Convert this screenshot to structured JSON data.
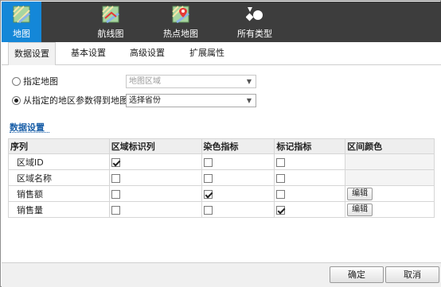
{
  "ribbon": {
    "chart_types": [
      {
        "label": "地图",
        "icon": "map-icon",
        "active": true
      },
      {
        "label": "航线图",
        "icon": "route-map-icon",
        "active": false
      },
      {
        "label": "热点地图",
        "icon": "hotspot-map-icon",
        "active": false
      },
      {
        "label": "所有类型",
        "icon": "all-types-icon",
        "active": false
      }
    ]
  },
  "tabs": [
    {
      "label": "数据设置",
      "active": true
    },
    {
      "label": "基本设置",
      "active": false
    },
    {
      "label": "高级设置",
      "active": false
    },
    {
      "label": "扩展属性",
      "active": false
    }
  ],
  "map_source": {
    "option_specified": {
      "label": "指定地图",
      "checked": false,
      "select_value": "地图区域"
    },
    "option_from_param": {
      "label": "从指定的地区参数得到地图",
      "checked": true,
      "select_value": "选择省份"
    }
  },
  "data_settings": {
    "title": "数据设置",
    "columns": [
      "序列",
      "区域标识列",
      "染色指标",
      "标记指标",
      "区间颜色"
    ],
    "rows": [
      {
        "name": "区域ID",
        "region_id": true,
        "color_metric": false,
        "mark_metric": false,
        "range_color": ""
      },
      {
        "name": "区域名称",
        "region_id": false,
        "color_metric": false,
        "mark_metric": false,
        "range_color": ""
      },
      {
        "name": "销售额",
        "region_id": false,
        "color_metric": true,
        "mark_metric": false,
        "range_color": "编辑"
      },
      {
        "name": "销售量",
        "region_id": false,
        "color_metric": false,
        "mark_metric": true,
        "range_color": "编辑"
      }
    ]
  },
  "footer": {
    "ok_label": "确定",
    "cancel_label": "取消"
  },
  "colors": {
    "ribbon_bg": "#3d3d3d",
    "active_accent": "#1487d8",
    "section_title": "#1a5fa8"
  }
}
